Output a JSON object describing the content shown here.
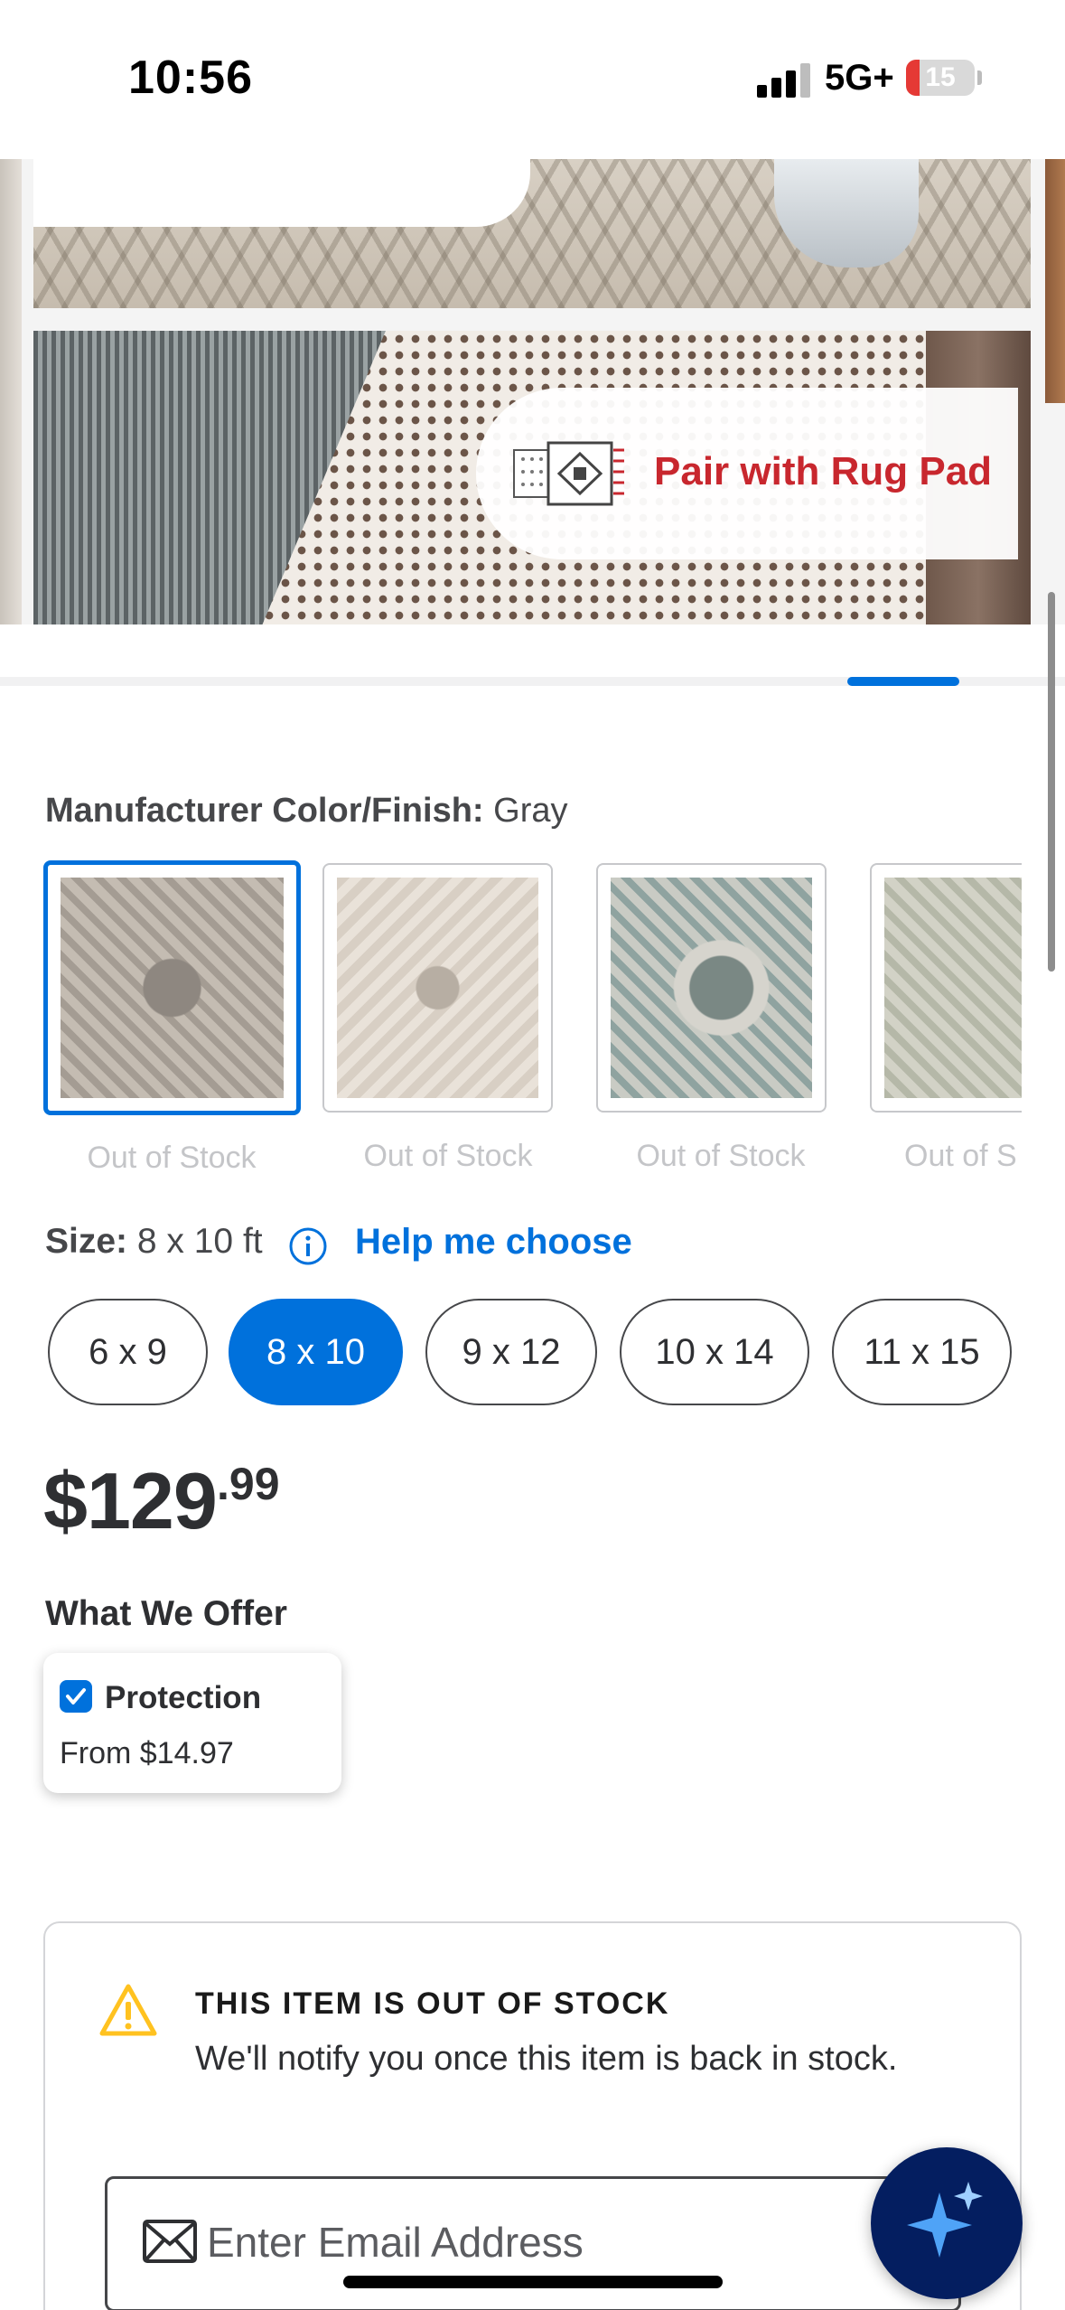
{
  "status_bar": {
    "time": "10:56",
    "network": "5G+",
    "battery": "15"
  },
  "hero": {
    "promo_text": "Pair with Rug Pad",
    "icon_name": "rug-pad-icon"
  },
  "color": {
    "label": "Manufacturer Color/Finish:",
    "value": "Gray",
    "swatches": [
      {
        "status": "Out of Stock"
      },
      {
        "status": "Out of Stock"
      },
      {
        "status": "Out of Stock"
      },
      {
        "status": "Out of S"
      }
    ]
  },
  "size": {
    "label": "Size:",
    "value": "8 x 10 ft",
    "help_link": "Help me choose",
    "options": [
      "6 x 9",
      "8 x 10",
      "9 x 12",
      "10 x 14",
      "11 x 15"
    ],
    "selected": "8 x 10"
  },
  "price": {
    "dollars": "$129",
    "cents": ".99"
  },
  "offer": {
    "title": "What We Offer",
    "name": "Protection",
    "price": "From $14.97"
  },
  "stock": {
    "title": "THIS ITEM IS OUT OF STOCK",
    "message": "We'll notify you once this item is back in stock.",
    "email_placeholder": "Enter Email Address"
  },
  "colors": {
    "accent": "#0071dc",
    "fab": "#041e60",
    "promo_red": "#c8272e",
    "warning": "#ffc220"
  }
}
